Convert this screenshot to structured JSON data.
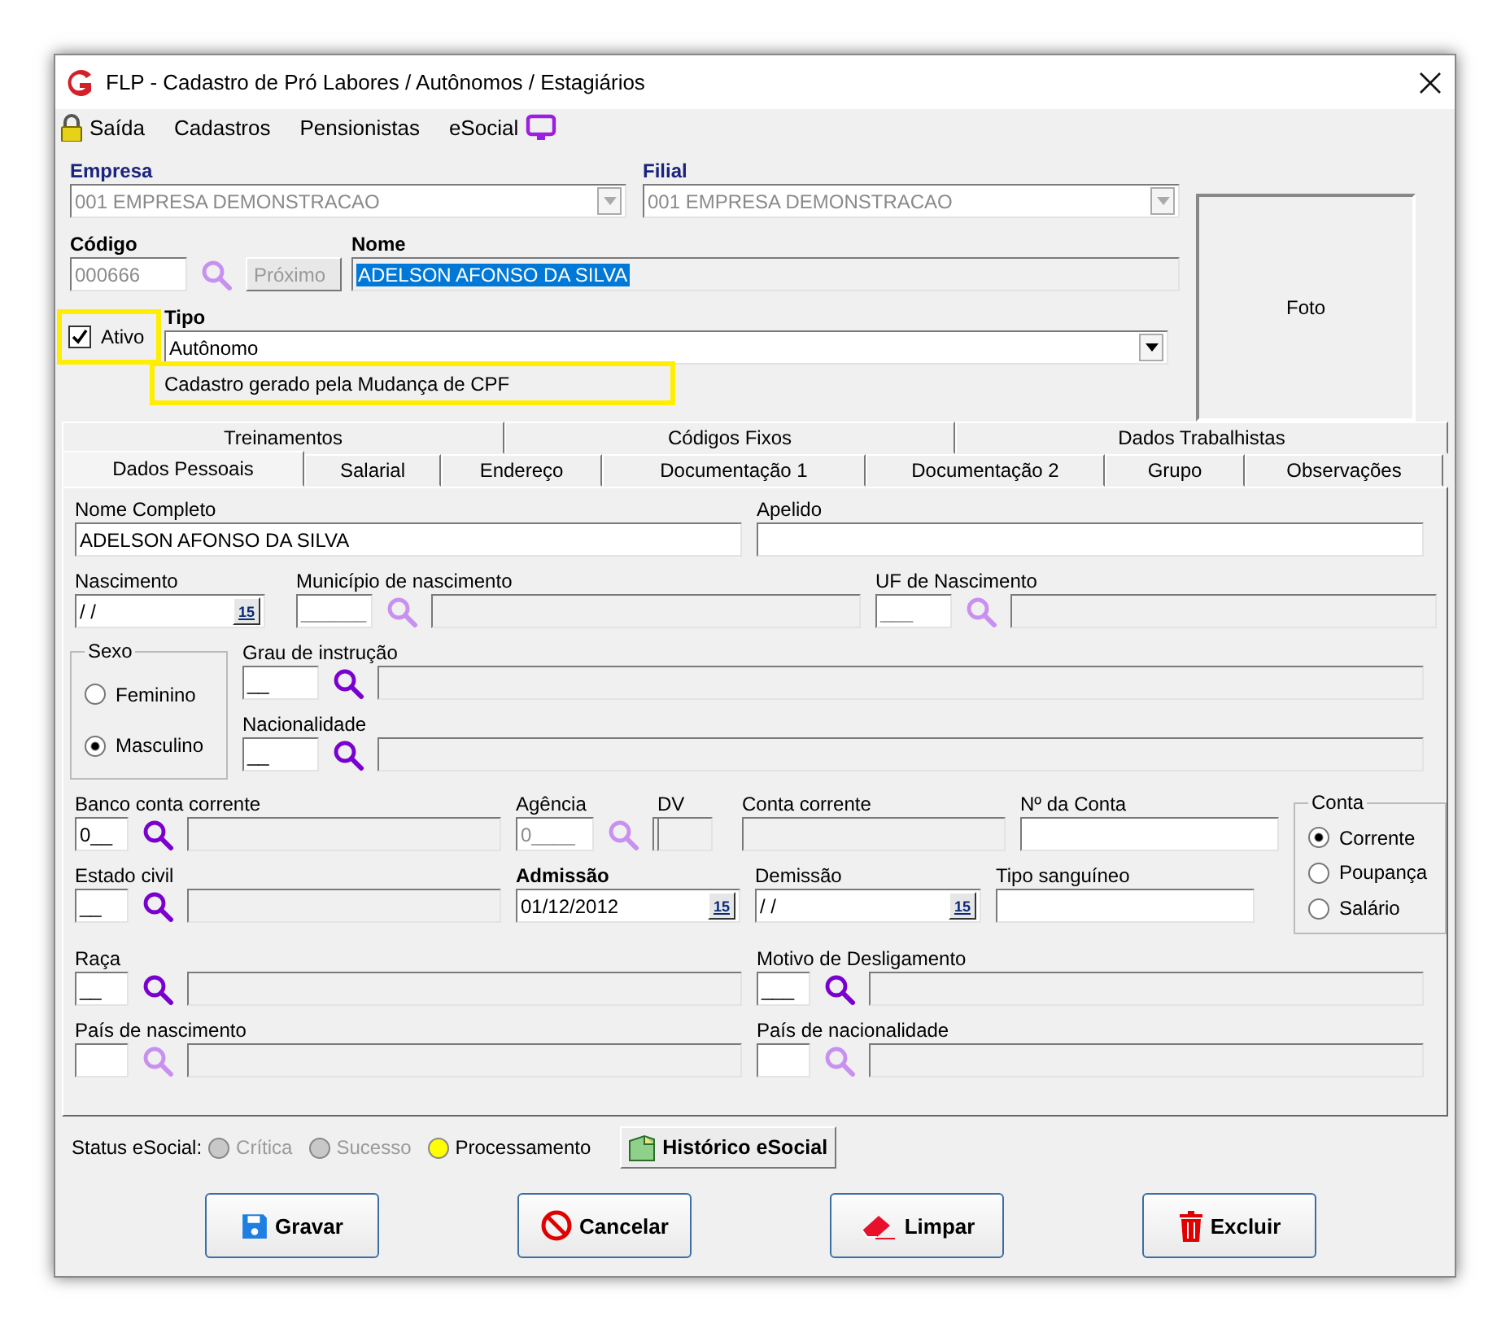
{
  "window": {
    "title": "FLP - Cadastro de Pró Labores / Autônomos / Estagiários"
  },
  "menu": [
    {
      "label": "Saída"
    },
    {
      "label": "Cadastros"
    },
    {
      "label": "Pensionistas"
    },
    {
      "label": "eSocial"
    }
  ],
  "header": {
    "empresa": {
      "label": "Empresa",
      "value": "001 EMPRESA DEMONSTRACAO",
      "disabled": true
    },
    "filial": {
      "label": "Filial",
      "value": "001 EMPRESA DEMONSTRACAO",
      "disabled": true
    },
    "codigo": {
      "label": "Código",
      "value": "000666"
    },
    "proximo": {
      "label": "Próximo",
      "disabled": true
    },
    "nome": {
      "label": "Nome",
      "value": "ADELSON AFONSO DA SILVA",
      "text_selected": true
    },
    "ativo": {
      "label": "Ativo",
      "checked": true
    },
    "tipo": {
      "label": "Tipo",
      "value": "Autônomo"
    },
    "note": "Cadastro gerado pela Mudança de CPF",
    "foto": "Foto"
  },
  "tab_rows": [
    {
      "tabs": [
        {
          "label": "Treinamentos",
          "selected": false
        },
        {
          "label": "Códigos Fixos",
          "selected": false
        },
        {
          "label": "Dados Trabalhistas",
          "selected": false
        }
      ]
    },
    {
      "tabs": [
        {
          "label": "Dados Pessoais",
          "selected": true
        },
        {
          "label": "Salarial",
          "selected": false
        },
        {
          "label": "Endereço",
          "selected": false
        },
        {
          "label": "Documentação 1",
          "selected": false
        },
        {
          "label": "Documentação 2",
          "selected": false
        },
        {
          "label": "Grupo",
          "selected": false
        },
        {
          "label": "Observações",
          "selected": false
        }
      ]
    }
  ],
  "dados_pessoais": {
    "nome_completo": {
      "label": "Nome Completo",
      "value": "ADELSON AFONSO DA SILVA"
    },
    "apelido": {
      "label": "Apelido"
    },
    "nascimento": {
      "label": "Nascimento",
      "value": "/ /",
      "button": "15"
    },
    "municipio": {
      "label": "Município de nascimento",
      "code": "______",
      "disabled": true
    },
    "uf": {
      "label": "UF de Nascimento",
      "code": "___",
      "disabled": true
    },
    "sexo": {
      "label": "Sexo",
      "options": [
        {
          "label": "Feminino",
          "selected": false
        },
        {
          "label": "Masculino",
          "selected": true
        }
      ]
    },
    "grau": {
      "label": "Grau de instrução",
      "code": "__",
      "disabled": false
    },
    "nacionalidade": {
      "label": "Nacionalidade",
      "code": "__",
      "disabled": false
    },
    "banco": {
      "label": "Banco conta corrente",
      "code": "0__",
      "disabled": false
    },
    "agencia": {
      "label": "Agência",
      "code": "0____",
      "disabled": true
    },
    "dv": {
      "label": "DV"
    },
    "conta_corrente": {
      "label": "Conta corrente"
    },
    "numero_conta": {
      "label": "Nº da Conta"
    },
    "conta": {
      "label": "Conta",
      "options": [
        {
          "label": "Corrente",
          "selected": true
        },
        {
          "label": "Poupança",
          "selected": false
        },
        {
          "label": "Salário",
          "selected": false
        }
      ]
    },
    "estado_civil": {
      "label": "Estado civil",
      "code": "__",
      "disabled": false
    },
    "admissao": {
      "label": "Admissão",
      "value": "01/12/2012",
      "button": "15",
      "required": true
    },
    "demissao": {
      "label": "Demissão",
      "value": "/ /",
      "button": "15",
      "required": false
    },
    "tipo_sanguineo": {
      "label": "Tipo sanguíneo"
    },
    "raca": {
      "label": "Raça",
      "code": "__",
      "disabled": false
    },
    "motivo": {
      "label": "Motivo de Desligamento",
      "code": "___",
      "disabled": false
    },
    "pais_nascimento": {
      "label": "País de nascimento",
      "disabled": true
    },
    "pais_nacionalidade": {
      "label": "País de nacionalidade",
      "disabled": true
    }
  },
  "status": {
    "label": "Status eSocial:",
    "indicators": [
      {
        "label": "Crítica",
        "color": "#c8c8c8",
        "disabled": true
      },
      {
        "label": "Sucesso",
        "color": "#c8c8c8",
        "disabled": true
      },
      {
        "label": "Processamento",
        "color": "#ffff00",
        "disabled": false
      }
    ],
    "history_button": "Histórico eSocial"
  },
  "buttons": [
    {
      "label": "Gravar",
      "kind": "save"
    },
    {
      "label": "Cancelar",
      "kind": "cancel"
    },
    {
      "label": "Limpar",
      "kind": "clear"
    },
    {
      "label": "Excluir",
      "kind": "delete"
    }
  ]
}
